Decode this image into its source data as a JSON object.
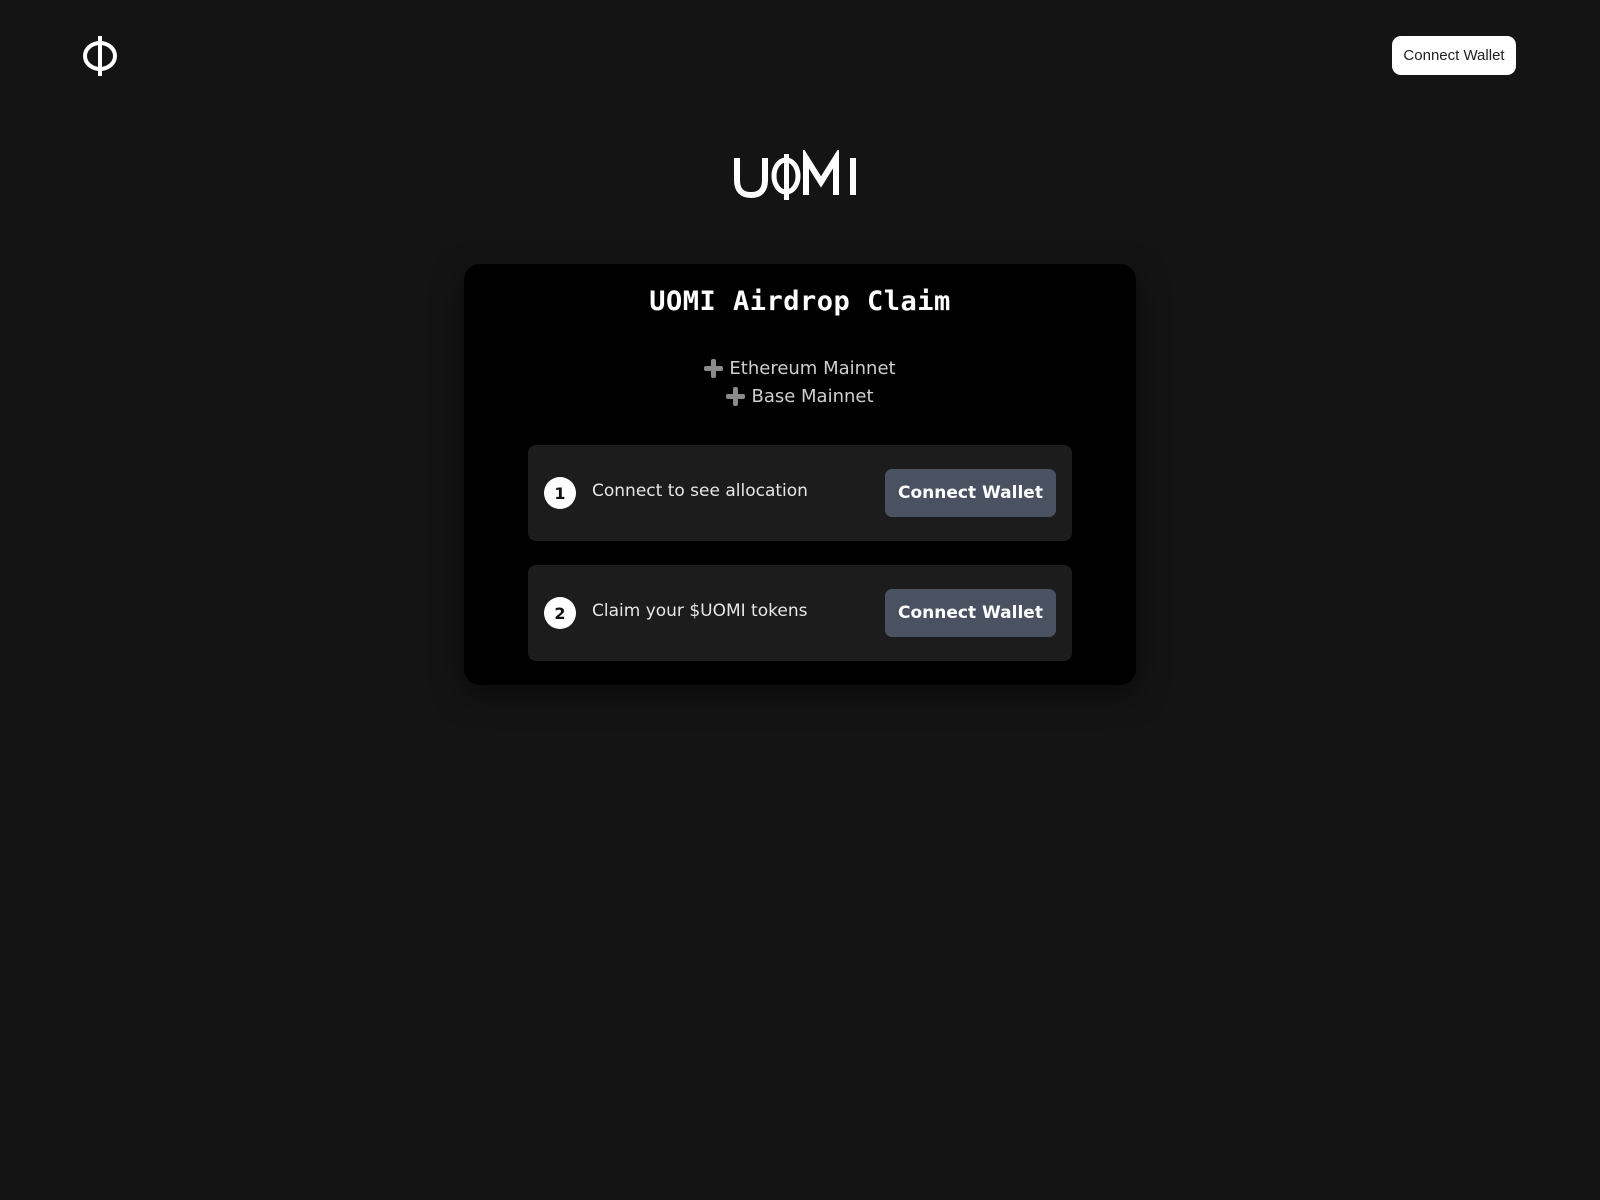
{
  "header": {
    "logo_icon": "phi-logo-icon",
    "connect_label": "Connect Wallet"
  },
  "brand": {
    "wordmark": "UOMI"
  },
  "card": {
    "title": "UOMI Airdrop Claim",
    "networks": [
      {
        "icon": "plus-icon",
        "label": "Ethereum Mainnet"
      },
      {
        "icon": "plus-icon",
        "label": "Base Mainnet"
      }
    ],
    "steps": [
      {
        "number": "1",
        "text": "Connect to see allocation",
        "button": "Connect Wallet"
      },
      {
        "number": "2",
        "text": "Claim your $UOMI tokens",
        "button": "Connect Wallet"
      }
    ]
  },
  "colors": {
    "background": "#141414",
    "card": "#000000",
    "step_panel": "#1c1c1c",
    "step_button": "#4a5262"
  }
}
